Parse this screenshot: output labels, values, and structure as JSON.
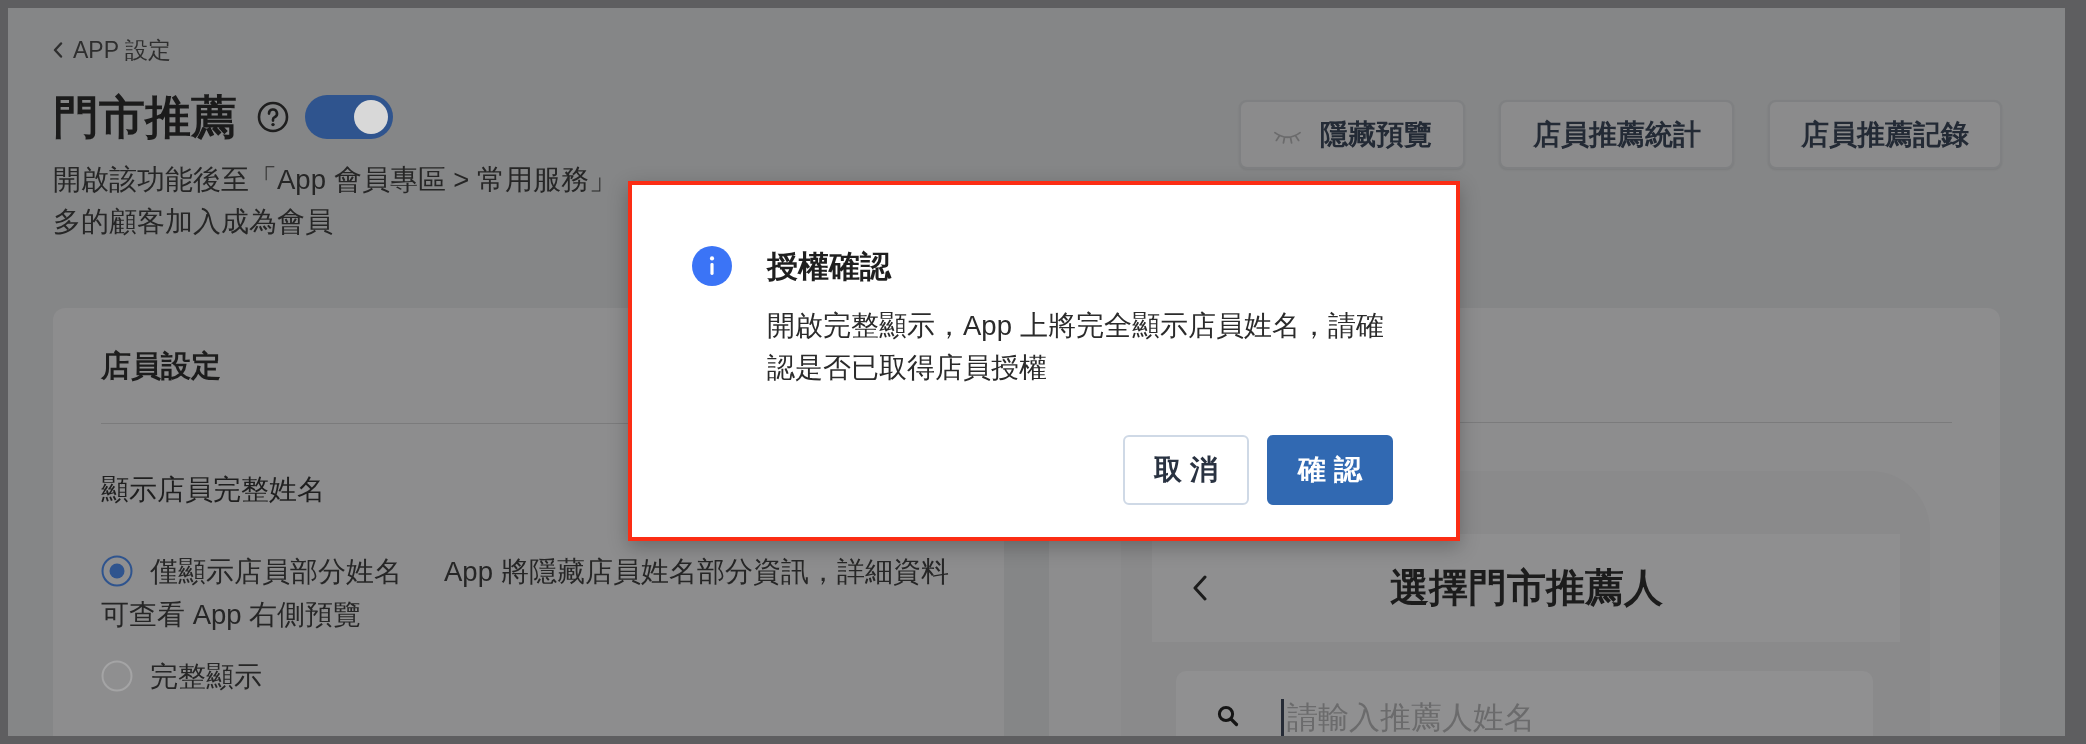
{
  "back_link": {
    "label": "APP 設定"
  },
  "header": {
    "title": "門市推薦",
    "toggle": {
      "on": true
    },
    "description_lines": [
      "開啟該功能後至「App 會員專區 > 常用服務」",
      "多的顧客加入成為會員"
    ]
  },
  "actions": [
    {
      "label": "隱藏預覽",
      "kind": "icon"
    },
    {
      "label": "店員推薦統計",
      "kind": "text"
    },
    {
      "label": "店員推薦記錄",
      "kind": "text"
    }
  ],
  "staff_settings": {
    "title": "店員設定",
    "field_label": "顯示店員完整姓名",
    "options": [
      {
        "label": "僅顯示店員部分姓名",
        "hint": "App 將隱藏店員姓名部分資訊，詳細資料可查看 App 右側預覽",
        "selected": true
      },
      {
        "label": "完整顯示",
        "selected": false
      }
    ]
  },
  "preview": {
    "screen_title": "選擇門市推薦人",
    "search": {
      "placeholder": "請輸入推薦人姓名",
      "focused": true
    }
  },
  "dialog": {
    "title": "授權確認",
    "message": "開啟完整顯示，App 上將完全顯示店員姓名，請確認是否已取得店員授權",
    "buttons": [
      {
        "label": "取 消",
        "kind": "secondary"
      },
      {
        "label": "確 認",
        "kind": "primary"
      }
    ]
  }
}
